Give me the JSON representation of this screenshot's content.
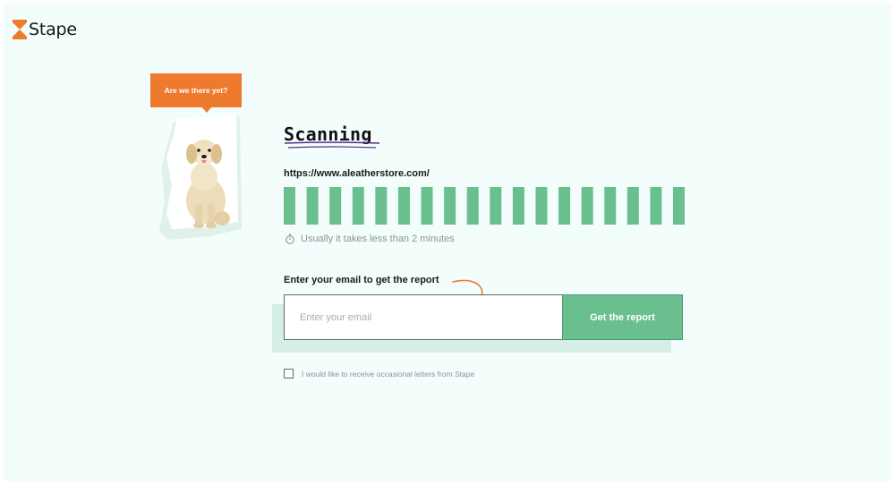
{
  "brand": {
    "name": "Stape",
    "accent": "#ee7a2e",
    "green": "#6abf8e",
    "background": "#f3fdfc"
  },
  "speech_bubble": {
    "text": "Are we there yet?"
  },
  "scan": {
    "title": "Scanning",
    "url": "https://www.aleatherstore.com/",
    "progress_segments": 18,
    "progress_filled": 18,
    "hint": "Usually it takes less than 2 minutes",
    "hint_icon": "stopwatch-icon"
  },
  "form": {
    "label": "Enter your email to get the report",
    "email_placeholder": "Enter your email",
    "email_value": "",
    "submit_label": "Get the report"
  },
  "consent": {
    "checked": false,
    "text": "I would like to receive occasional letters from Stape"
  }
}
